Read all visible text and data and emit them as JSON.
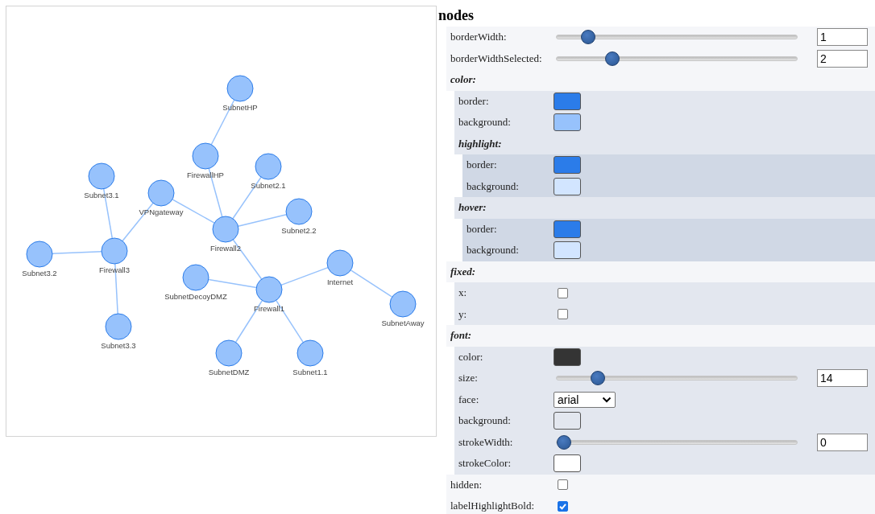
{
  "network": {
    "nodes": [
      {
        "label": "SubnetHP"
      },
      {
        "label": "FirewallHP"
      },
      {
        "label": "Subnet2.1"
      },
      {
        "label": "Subnet3.1"
      },
      {
        "label": "VPNgateway"
      },
      {
        "label": "Subnet2.2"
      },
      {
        "label": "Firewall2"
      },
      {
        "label": "Subnet3.2"
      },
      {
        "label": "Firewall3"
      },
      {
        "label": "Internet"
      },
      {
        "label": "SubnetDecoyDMZ"
      },
      {
        "label": "Firewall1"
      },
      {
        "label": "SubnetAway"
      },
      {
        "label": "Subnet3.3"
      },
      {
        "label": "SubnetDMZ"
      },
      {
        "label": "Subnet1.1"
      }
    ]
  },
  "panel": {
    "title": "nodes",
    "items": [
      {
        "kind": "slider",
        "label": "borderWidth:",
        "level": 0.1,
        "value": "1"
      },
      {
        "kind": "slider",
        "label": "borderWidthSelected:",
        "level": 0.2,
        "value": "2"
      },
      {
        "kind": "group",
        "label": "color:",
        "children": [
          {
            "kind": "color",
            "label": "border:",
            "color": "#2b7ce9"
          },
          {
            "kind": "color",
            "label": "background:",
            "color": "#97c2fc"
          },
          {
            "kind": "group",
            "label": "highlight:",
            "children": [
              {
                "kind": "color",
                "label": "border:",
                "color": "#2b7ce9"
              },
              {
                "kind": "color",
                "label": "background:",
                "color": "#d2e5ff"
              }
            ]
          },
          {
            "kind": "group",
            "label": "hover:",
            "children": [
              {
                "kind": "color",
                "label": "border:",
                "color": "#2b7ce9"
              },
              {
                "kind": "color",
                "label": "background:",
                "color": "#d2e5ff"
              }
            ]
          }
        ]
      },
      {
        "kind": "group",
        "label": "fixed:",
        "children": [
          {
            "kind": "checkbox",
            "label": "x:",
            "checked": false
          },
          {
            "kind": "checkbox",
            "label": "y:",
            "checked": false
          }
        ]
      },
      {
        "kind": "group",
        "label": "font:",
        "children": [
          {
            "kind": "color",
            "label": "color:",
            "color": "#343434"
          },
          {
            "kind": "slider",
            "label": "size:",
            "level": 0.14,
            "value": "14"
          },
          {
            "kind": "select",
            "label": "face:",
            "value": "arial"
          },
          {
            "kind": "color",
            "label": "background:",
            "color": "#e3e7ef"
          },
          {
            "kind": "slider",
            "label": "strokeWidth:",
            "level": 0,
            "value": "0"
          },
          {
            "kind": "color",
            "label": "strokeColor:",
            "color": "#ffffff"
          }
        ]
      },
      {
        "kind": "checkbox",
        "label": "hidden:",
        "checked": false
      },
      {
        "kind": "checkbox",
        "label": "labelHighlightBold:",
        "checked": true
      }
    ]
  }
}
